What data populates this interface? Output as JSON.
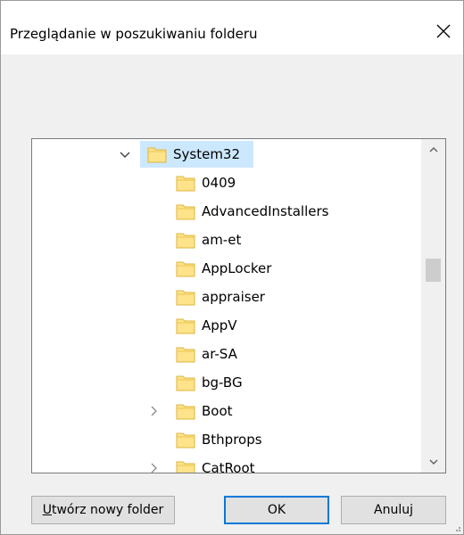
{
  "dialog": {
    "title": "Przeglądanie w poszukiwaniu folderu",
    "close_label": "×"
  },
  "tree": {
    "items": [
      {
        "label": "System32",
        "expanded": true,
        "selected": true,
        "has_children": true
      },
      {
        "label": "0409"
      },
      {
        "label": "AdvancedInstallers"
      },
      {
        "label": "am-et"
      },
      {
        "label": "AppLocker"
      },
      {
        "label": "appraiser"
      },
      {
        "label": "AppV"
      },
      {
        "label": "ar-SA"
      },
      {
        "label": "bg-BG"
      },
      {
        "label": "Boot",
        "has_children": true
      },
      {
        "label": "Bthprops"
      },
      {
        "label": "CatRoot",
        "has_children": true
      }
    ]
  },
  "buttons": {
    "new_folder_first": "U",
    "new_folder_rest": "twórz nowy folder",
    "ok": "OK",
    "cancel": "Anuluj"
  },
  "colors": {
    "selection": "#cce8ff",
    "folder": "#ffe38a",
    "focus_border": "#0078d7"
  }
}
